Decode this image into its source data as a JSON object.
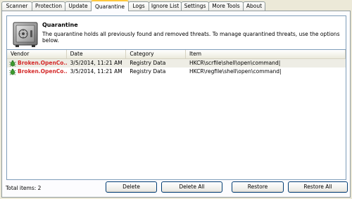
{
  "tabs": [
    {
      "label": "Scanner",
      "active": false
    },
    {
      "label": "Protection",
      "active": false
    },
    {
      "label": "Update",
      "active": false
    },
    {
      "label": "Quarantine",
      "active": true
    },
    {
      "label": "Logs",
      "active": false
    },
    {
      "label": "Ignore List",
      "active": false
    },
    {
      "label": "Settings",
      "active": false
    },
    {
      "label": "More Tools",
      "active": false
    },
    {
      "label": "About",
      "active": false
    }
  ],
  "header": {
    "icon": "safe-icon",
    "title": "Quarantine",
    "description": "The quarantine holds all previously found and removed threats. To manage quarantined threats, use the options below."
  },
  "table": {
    "columns": [
      "Vendor",
      "Date",
      "Category",
      "Item"
    ],
    "rows": [
      {
        "vendor": "Broken.OpenCo...",
        "date": "3/5/2014, 11:21 AM",
        "category": "Registry Data",
        "item": "HKCR\\scrfile\\shell\\open\\command|",
        "icon": "bug-icon",
        "selected": true
      },
      {
        "vendor": "Broken.OpenCo...",
        "date": "3/5/2014, 11:21 AM",
        "category": "Registry Data",
        "item": "HKCR\\regfile\\shell\\open\\command|",
        "icon": "bug-icon",
        "selected": false
      }
    ]
  },
  "footer": {
    "total_label": "Total items: 2",
    "buttons": {
      "delete": "Delete",
      "delete_all": "Delete All",
      "restore": "Restore",
      "restore_all": "Restore All"
    }
  },
  "colors": {
    "threat_text": "#d42a2a",
    "active_tab_accent": "#ffc83c",
    "window_bg": "#ece9d8"
  }
}
